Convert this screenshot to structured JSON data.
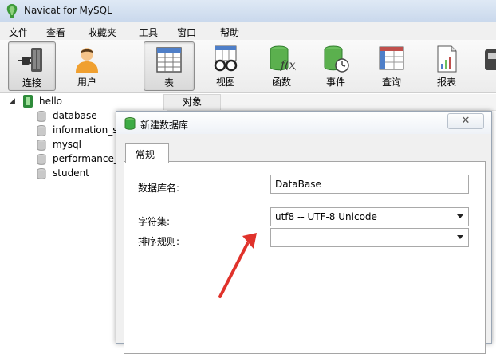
{
  "window": {
    "title": "Navicat for MySQL"
  },
  "menu": [
    "文件",
    "查看",
    "收藏夹",
    "工具",
    "窗口",
    "帮助"
  ],
  "toolbar": [
    {
      "label": "连接",
      "icon": "connection-icon",
      "active": true
    },
    {
      "label": "用户",
      "icon": "user-icon",
      "active": false
    },
    {
      "label": "表",
      "icon": "table-icon",
      "active": true
    },
    {
      "label": "视图",
      "icon": "view-icon",
      "active": false
    },
    {
      "label": "函数",
      "icon": "function-icon",
      "active": false
    },
    {
      "label": "事件",
      "icon": "event-icon",
      "active": false
    },
    {
      "label": "查询",
      "icon": "query-icon",
      "active": false
    },
    {
      "label": "报表",
      "icon": "report-icon",
      "active": false
    }
  ],
  "tree": {
    "connection": "hello",
    "databases": [
      "database",
      "information_s",
      "mysql",
      "performance_",
      "student"
    ]
  },
  "objects_tab": {
    "label": "对象"
  },
  "dialog": {
    "title": "新建数据库",
    "close_glyph": "✕",
    "tab": "常规",
    "fields": {
      "name": {
        "label": "数据库名:",
        "value": "DataBase"
      },
      "charset": {
        "label": "字符集:",
        "value": "utf8 -- UTF-8 Unicode"
      },
      "collation": {
        "label": "排序规则:",
        "value": ""
      }
    }
  },
  "colors": {
    "annotation_arrow": "#e0322b",
    "db_icon_green": "#3cab45"
  }
}
